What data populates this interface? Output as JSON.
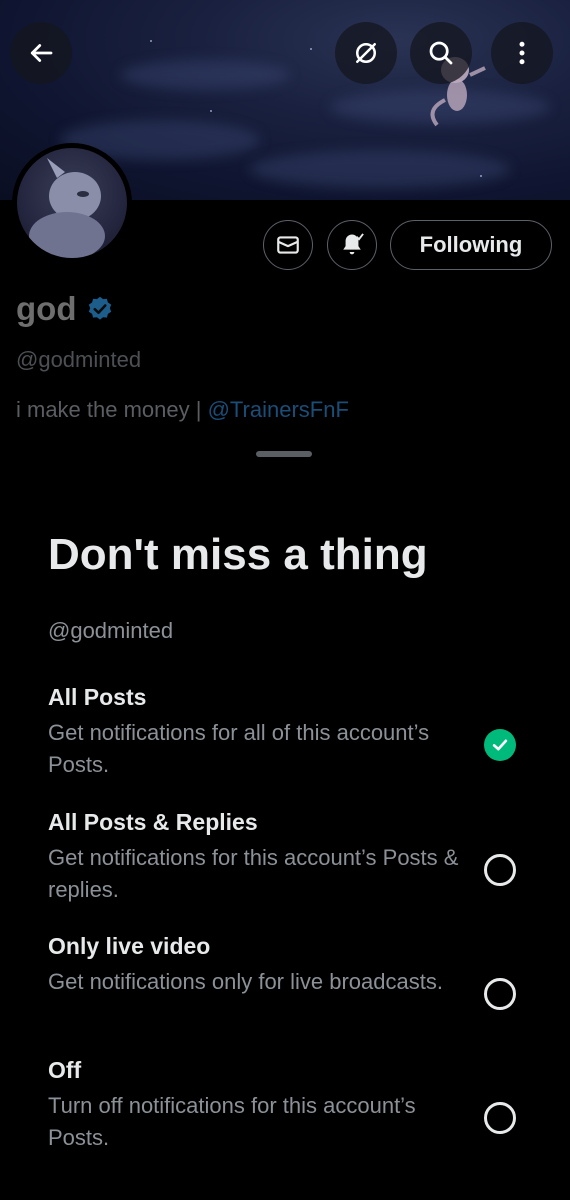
{
  "profile": {
    "name": "god",
    "handle": "@godminted",
    "bio_text": "i make the money | ",
    "bio_mention": "@TrainersFnF",
    "following_label": "Following"
  },
  "sheet": {
    "title": "Don't miss a thing",
    "subtitle": "@godminted",
    "options": [
      {
        "title": "All Posts",
        "desc": "Get notifications for all of this account’s Posts.",
        "selected": true
      },
      {
        "title": "All Posts & Replies",
        "desc": "Get notifications for this account’s Posts & replies.",
        "selected": false
      },
      {
        "title": "Only live video",
        "desc": "Get notifications only for live broadcasts.",
        "selected": false
      },
      {
        "title": "Off",
        "desc": "Turn off notifications for this account’s Posts.",
        "selected": false
      }
    ]
  },
  "icons": {
    "back": "arrow-left-icon",
    "no_translate": "circle-slash-icon",
    "search": "search-icon",
    "more": "more-vertical-icon",
    "message": "envelope-icon",
    "notify": "bell-check-icon",
    "verified": "verified-badge-icon",
    "check": "check-icon"
  },
  "colors": {
    "accent_green": "#00ba7c",
    "verified_blue": "#1d9bf0",
    "mention_blue": "#1a4d78",
    "sheet_bg": "#000000"
  }
}
